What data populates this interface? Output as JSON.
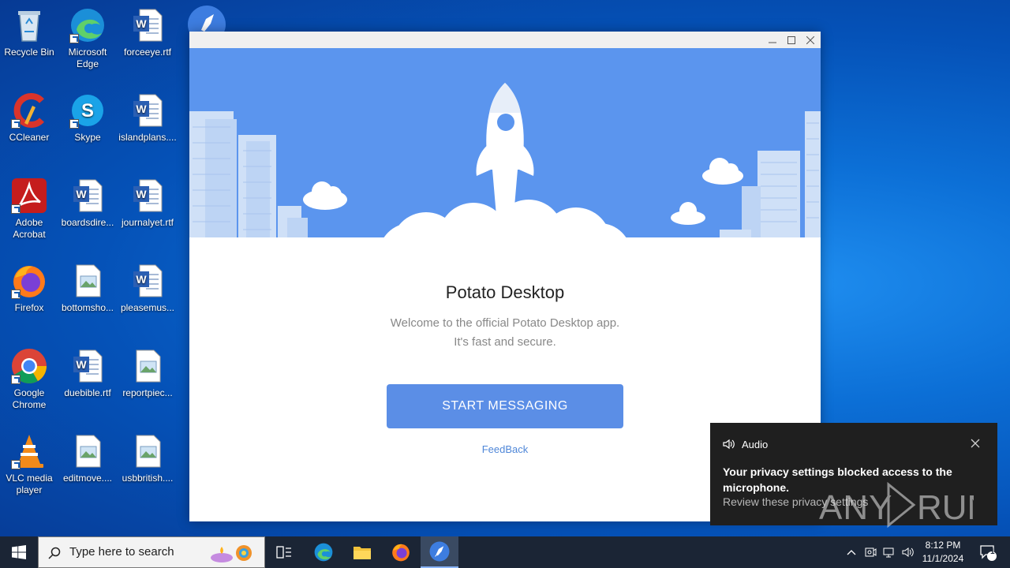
{
  "desktop": {
    "icons": [
      {
        "label": "Recycle Bin"
      },
      {
        "label": "Microsoft Edge"
      },
      {
        "label": "forceeye.rtf"
      },
      {
        "label": "CCleaner"
      },
      {
        "label": "Skype"
      },
      {
        "label": "islandplans...."
      },
      {
        "label": "Adobe Acrobat"
      },
      {
        "label": "boardsdire..."
      },
      {
        "label": "journalyet.rtf"
      },
      {
        "label": "Firefox"
      },
      {
        "label": "bottomsho..."
      },
      {
        "label": "pleasemus..."
      },
      {
        "label": "Google Chrome"
      },
      {
        "label": "duebible.rtf"
      },
      {
        "label": "reportpiec..."
      },
      {
        "label": "VLC media player"
      },
      {
        "label": "editmove...."
      },
      {
        "label": "usbbritish...."
      }
    ]
  },
  "app": {
    "title": "Potato Desktop",
    "subtitle_line1": "Welcome to the official Potato Desktop app.",
    "subtitle_line2": "It's fast and secure.",
    "start_button": "START MESSAGING",
    "feedback_link": "FeedBack"
  },
  "toast": {
    "app_name": "Audio",
    "title": "Your privacy settings blocked access to the microphone.",
    "body": "Review these privacy settings"
  },
  "watermark": {
    "text": "ANY RUN"
  },
  "taskbar": {
    "search_placeholder": "Type here to search",
    "time": "8:12 PM",
    "date": "11/1/2024",
    "notification_count": "1"
  },
  "colors": {
    "hero_sky": "#5b95ee",
    "primary_button": "#5b8ee6",
    "link": "#4f87d8",
    "toast_bg": "#1f1f1f",
    "taskbar_bg": "#1b2535"
  }
}
